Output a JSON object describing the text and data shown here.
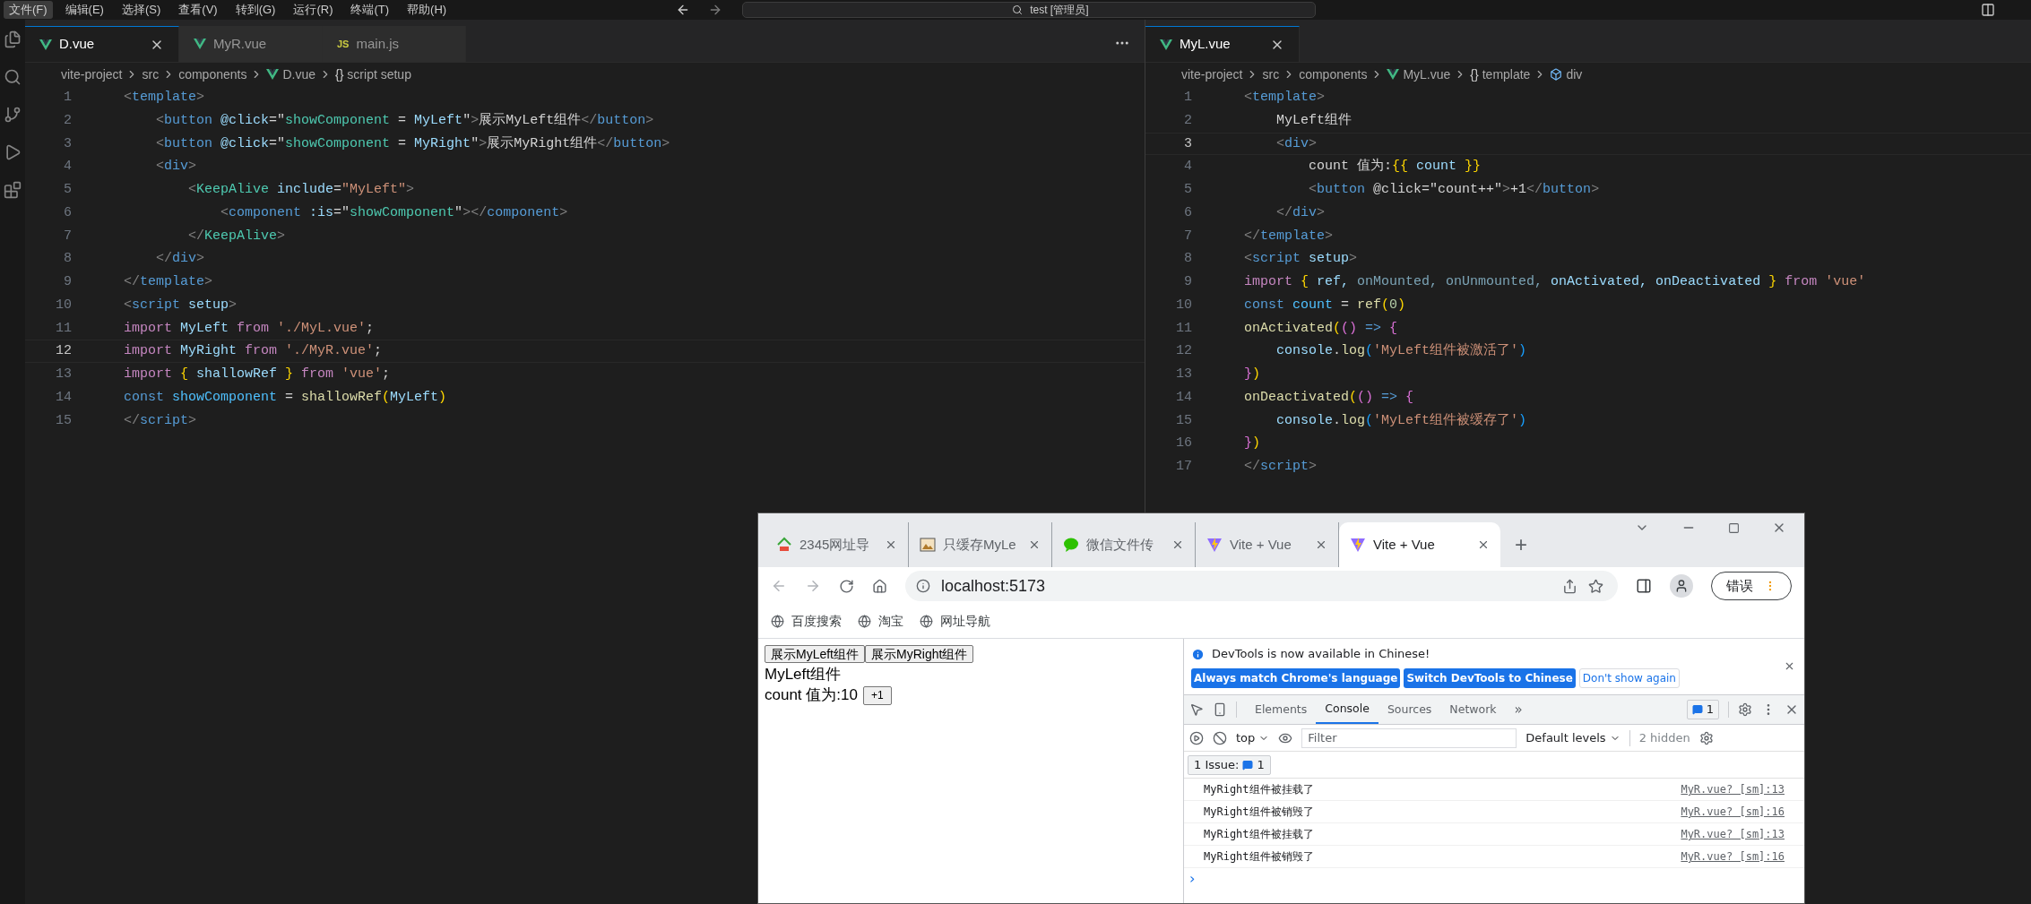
{
  "menu": [
    {
      "label": "文件(F)",
      "selected": true
    },
    {
      "label": "编辑(E)",
      "selected": false
    },
    {
      "label": "选择(S)",
      "selected": false
    },
    {
      "label": "查看(V)",
      "selected": false
    },
    {
      "label": "转到(G)",
      "selected": false
    },
    {
      "label": "运行(R)",
      "selected": false
    },
    {
      "label": "终端(T)",
      "selected": false
    },
    {
      "label": "帮助(H)",
      "selected": false
    }
  ],
  "command_center": {
    "value": "test [管理员]"
  },
  "editors": [
    {
      "tabs": [
        {
          "label": "D.vue",
          "kind": "vue",
          "selected": true
        },
        {
          "label": "MyR.vue",
          "kind": "vue",
          "selected": false
        },
        {
          "label": "main.js",
          "kind": "js",
          "badge": "JS",
          "selected": false
        }
      ],
      "breadcrumbs": [
        {
          "label": "vite-project",
          "kind": "folder"
        },
        {
          "label": "src",
          "kind": "folder"
        },
        {
          "label": "components",
          "kind": "folder"
        },
        {
          "label": "D.vue",
          "kind": "vue"
        },
        {
          "label": "script setup",
          "kind": "braces",
          "symbol": "{}"
        }
      ],
      "lines": [
        {
          "number": "1",
          "current": false,
          "tokens": [
            {
              "text": "<",
              "kind": "p"
            },
            {
              "text": "template",
              "kind": "tag"
            },
            {
              "text": ">",
              "kind": "p"
            }
          ]
        },
        {
          "number": "2",
          "current": false,
          "tokens": [
            {
              "text": "    <",
              "kind": "p"
            },
            {
              "text": "button ",
              "kind": "tag"
            },
            {
              "text": "@click",
              "kind": "attr"
            },
            {
              "text": "=\"",
              "kind": "pl"
            },
            {
              "text": "showComponent",
              "kind": "cls"
            },
            {
              "text": " = ",
              "kind": "pl"
            },
            {
              "text": "MyLeft",
              "kind": "var"
            },
            {
              "text": "\"",
              "kind": "pl"
            },
            {
              "text": ">",
              "kind": "p"
            },
            {
              "text": "展示MyLeft组件",
              "kind": "pl"
            },
            {
              "text": "</",
              "kind": "p"
            },
            {
              "text": "button",
              "kind": "tag"
            },
            {
              "text": ">",
              "kind": "p"
            }
          ]
        },
        {
          "number": "3",
          "current": false,
          "tokens": [
            {
              "text": "    <",
              "kind": "p"
            },
            {
              "text": "button ",
              "kind": "tag"
            },
            {
              "text": "@click",
              "kind": "attr"
            },
            {
              "text": "=\"",
              "kind": "pl"
            },
            {
              "text": "showComponent",
              "kind": "cls"
            },
            {
              "text": " = ",
              "kind": "pl"
            },
            {
              "text": "MyRight",
              "kind": "var"
            },
            {
              "text": "\"",
              "kind": "pl"
            },
            {
              "text": ">",
              "kind": "p"
            },
            {
              "text": "展示MyRight组件",
              "kind": "pl"
            },
            {
              "text": "</",
              "kind": "p"
            },
            {
              "text": "button",
              "kind": "tag"
            },
            {
              "text": ">",
              "kind": "p"
            }
          ]
        },
        {
          "number": "4",
          "current": false,
          "tokens": [
            {
              "text": "    <",
              "kind": "p"
            },
            {
              "text": "div",
              "kind": "tag"
            },
            {
              "text": ">",
              "kind": "p"
            }
          ]
        },
        {
          "number": "5",
          "current": false,
          "tokens": [
            {
              "text": "        <",
              "kind": "p"
            },
            {
              "text": "KeepAlive ",
              "kind": "cls"
            },
            {
              "text": "include",
              "kind": "attr"
            },
            {
              "text": "=",
              "kind": "pl"
            },
            {
              "text": "\"MyLeft\"",
              "kind": "str"
            },
            {
              "text": ">",
              "kind": "p"
            }
          ]
        },
        {
          "number": "6",
          "current": false,
          "tokens": [
            {
              "text": "            <",
              "kind": "p"
            },
            {
              "text": "component ",
              "kind": "tag"
            },
            {
              "text": ":is",
              "kind": "attr"
            },
            {
              "text": "=\"",
              "kind": "pl"
            },
            {
              "text": "showComponent",
              "kind": "cls"
            },
            {
              "text": "\"",
              "kind": "pl"
            },
            {
              "text": "></",
              "kind": "p"
            },
            {
              "text": "component",
              "kind": "tag"
            },
            {
              "text": ">",
              "kind": "p"
            }
          ]
        },
        {
          "number": "7",
          "current": false,
          "tokens": [
            {
              "text": "        </",
              "kind": "p"
            },
            {
              "text": "KeepAlive",
              "kind": "cls"
            },
            {
              "text": ">",
              "kind": "p"
            }
          ]
        },
        {
          "number": "8",
          "current": false,
          "tokens": [
            {
              "text": "    </",
              "kind": "p"
            },
            {
              "text": "div",
              "kind": "tag"
            },
            {
              "text": ">",
              "kind": "p"
            }
          ]
        },
        {
          "number": "9",
          "current": false,
          "tokens": [
            {
              "text": "</",
              "kind": "p"
            },
            {
              "text": "template",
              "kind": "tag"
            },
            {
              "text": ">",
              "kind": "p"
            }
          ]
        },
        {
          "number": "10",
          "current": false,
          "tokens": [
            {
              "text": "<",
              "kind": "p"
            },
            {
              "text": "script ",
              "kind": "tag"
            },
            {
              "text": "setup",
              "kind": "attr"
            },
            {
              "text": ">",
              "kind": "p"
            }
          ]
        },
        {
          "number": "11",
          "current": false,
          "tokens": [
            {
              "text": "import ",
              "kind": "kw"
            },
            {
              "text": "MyLeft ",
              "kind": "var"
            },
            {
              "text": "from ",
              "kind": "kw"
            },
            {
              "text": "'./MyL.vue'",
              "kind": "str"
            },
            {
              "text": ";",
              "kind": "pl"
            }
          ]
        },
        {
          "number": "12",
          "current": true,
          "tokens": [
            {
              "text": "import ",
              "kind": "kw"
            },
            {
              "text": "MyRight ",
              "kind": "var"
            },
            {
              "text": "from ",
              "kind": "kw"
            },
            {
              "text": "'./MyR.vue'",
              "kind": "str"
            },
            {
              "text": ";",
              "kind": "pl"
            }
          ]
        },
        {
          "number": "13",
          "current": false,
          "tokens": [
            {
              "text": "import ",
              "kind": "kw"
            },
            {
              "text": "{ ",
              "kind": "br"
            },
            {
              "text": "shallowRef ",
              "kind": "var"
            },
            {
              "text": "} ",
              "kind": "br"
            },
            {
              "text": "from ",
              "kind": "kw"
            },
            {
              "text": "'vue'",
              "kind": "str"
            },
            {
              "text": ";",
              "kind": "pl"
            }
          ]
        },
        {
          "number": "14",
          "current": false,
          "tokens": [
            {
              "text": "const ",
              "kind": "tag"
            },
            {
              "text": "showComponent",
              "kind": "cvar"
            },
            {
              "text": " = ",
              "kind": "pl"
            },
            {
              "text": "shallowRef",
              "kind": "fn"
            },
            {
              "text": "(",
              "kind": "br"
            },
            {
              "text": "MyLeft",
              "kind": "var"
            },
            {
              "text": ")",
              "kind": "br"
            }
          ]
        },
        {
          "number": "15",
          "current": false,
          "tokens": [
            {
              "text": "</",
              "kind": "p"
            },
            {
              "text": "script",
              "kind": "tag"
            },
            {
              "text": ">",
              "kind": "p"
            }
          ]
        }
      ]
    },
    {
      "tabs": [
        {
          "label": "MyL.vue",
          "kind": "vue",
          "selected": true
        }
      ],
      "breadcrumbs": [
        {
          "label": "vite-project",
          "kind": "folder"
        },
        {
          "label": "src",
          "kind": "folder"
        },
        {
          "label": "components",
          "kind": "folder"
        },
        {
          "label": "MyL.vue",
          "kind": "vue"
        },
        {
          "label": "template",
          "kind": "braces",
          "symbol": "{}"
        },
        {
          "label": "div",
          "kind": "cube"
        }
      ],
      "lines": [
        {
          "number": "1",
          "current": false,
          "tokens": [
            {
              "text": "<",
              "kind": "p"
            },
            {
              "text": "template",
              "kind": "tag"
            },
            {
              "text": ">",
              "kind": "p"
            }
          ]
        },
        {
          "number": "2",
          "current": false,
          "tokens": [
            {
              "text": "    MyLeft组件",
              "kind": "pl"
            }
          ]
        },
        {
          "number": "3",
          "current": true,
          "tokens": [
            {
              "text": "    <",
              "kind": "p"
            },
            {
              "text": "div",
              "kind": "tag"
            },
            {
              "text": ">",
              "kind": "p"
            }
          ]
        },
        {
          "number": "4",
          "current": false,
          "tokens": [
            {
              "text": "        count 值为:",
              "kind": "pl"
            },
            {
              "text": "{{ ",
              "kind": "br"
            },
            {
              "text": "count ",
              "kind": "var"
            },
            {
              "text": "}}",
              "kind": "br"
            }
          ]
        },
        {
          "number": "5",
          "current": false,
          "tokens": [
            {
              "text": "        <",
              "kind": "p"
            },
            {
              "text": "button ",
              "kind": "tag"
            },
            {
              "text": "@click=\"count++\"",
              "kind": "pl"
            },
            {
              "text": ">",
              "kind": "p"
            },
            {
              "text": "+1",
              "kind": "pl"
            },
            {
              "text": "</",
              "kind": "p"
            },
            {
              "text": "button",
              "kind": "tag"
            },
            {
              "text": ">",
              "kind": "p"
            }
          ]
        },
        {
          "number": "6",
          "current": false,
          "tokens": [
            {
              "text": "    </",
              "kind": "p"
            },
            {
              "text": "div",
              "kind": "tag"
            },
            {
              "text": ">",
              "kind": "p"
            }
          ]
        },
        {
          "number": "7",
          "current": false,
          "tokens": [
            {
              "text": "</",
              "kind": "p"
            },
            {
              "text": "template",
              "kind": "tag"
            },
            {
              "text": ">",
              "kind": "p"
            }
          ]
        },
        {
          "number": "8",
          "current": false,
          "tokens": [
            {
              "text": "<",
              "kind": "p"
            },
            {
              "text": "script ",
              "kind": "tag"
            },
            {
              "text": "setup",
              "kind": "attr"
            },
            {
              "text": ">",
              "kind": "p"
            }
          ]
        },
        {
          "number": "9",
          "current": false,
          "tokens": [
            {
              "text": "import ",
              "kind": "kw"
            },
            {
              "text": "{ ",
              "kind": "br"
            },
            {
              "text": "ref, ",
              "kind": "var"
            },
            {
              "text": "onMounted, onUnmounted, ",
              "kind": "dim"
            },
            {
              "text": "onActivated, onDeactivated ",
              "kind": "var"
            },
            {
              "text": "} ",
              "kind": "br"
            },
            {
              "text": "from ",
              "kind": "kw"
            },
            {
              "text": "'vue'",
              "kind": "str"
            }
          ]
        },
        {
          "number": "10",
          "current": false,
          "tokens": [
            {
              "text": "const ",
              "kind": "tag"
            },
            {
              "text": "count",
              "kind": "cvar"
            },
            {
              "text": " = ",
              "kind": "pl"
            },
            {
              "text": "ref",
              "kind": "fn"
            },
            {
              "text": "(",
              "kind": "br"
            },
            {
              "text": "0",
              "kind": "num"
            },
            {
              "text": ")",
              "kind": "br"
            }
          ]
        },
        {
          "number": "11",
          "current": false,
          "tokens": [
            {
              "text": "onActivated",
              "kind": "fn"
            },
            {
              "text": "(",
              "kind": "br"
            },
            {
              "text": "()",
              "kind": "br2"
            },
            {
              "text": " => ",
              "kind": "tag"
            },
            {
              "text": "{",
              "kind": "br2"
            }
          ]
        },
        {
          "number": "12",
          "current": false,
          "tokens": [
            {
              "text": "    console",
              "kind": "var"
            },
            {
              "text": ".",
              "kind": "pl"
            },
            {
              "text": "log",
              "kind": "fn"
            },
            {
              "text": "(",
              "kind": "br3"
            },
            {
              "text": "'MyLeft组件被激活了'",
              "kind": "str"
            },
            {
              "text": ")",
              "kind": "br3"
            }
          ]
        },
        {
          "number": "13",
          "current": false,
          "tokens": [
            {
              "text": "}",
              "kind": "br2"
            },
            {
              "text": ")",
              "kind": "br"
            }
          ]
        },
        {
          "number": "14",
          "current": false,
          "tokens": [
            {
              "text": "onDeactivated",
              "kind": "fn"
            },
            {
              "text": "(",
              "kind": "br"
            },
            {
              "text": "()",
              "kind": "br2"
            },
            {
              "text": " => ",
              "kind": "tag"
            },
            {
              "text": "{",
              "kind": "br2"
            }
          ]
        },
        {
          "number": "15",
          "current": false,
          "tokens": [
            {
              "text": "    console",
              "kind": "var"
            },
            {
              "text": ".",
              "kind": "pl"
            },
            {
              "text": "log",
              "kind": "fn"
            },
            {
              "text": "(",
              "kind": "br3"
            },
            {
              "text": "'MyLeft组件被缓存了'",
              "kind": "str"
            },
            {
              "text": ")",
              "kind": "br3"
            }
          ]
        },
        {
          "number": "16",
          "current": false,
          "tokens": [
            {
              "text": "}",
              "kind": "br2"
            },
            {
              "text": ")",
              "kind": "br"
            }
          ]
        },
        {
          "number": "17",
          "current": false,
          "tokens": [
            {
              "text": "</",
              "kind": "p"
            },
            {
              "text": "script",
              "kind": "tag"
            },
            {
              "text": ">",
              "kind": "p"
            }
          ]
        }
      ]
    }
  ],
  "browser": {
    "tabs": [
      {
        "title": "2345网址导",
        "kind": "house",
        "selected": false
      },
      {
        "title": "只缓存MyLe",
        "kind": "image",
        "selected": false
      },
      {
        "title": "微信文件传",
        "kind": "chat",
        "selected": false
      },
      {
        "title": "Vite + Vue",
        "kind": "vite",
        "selected": false
      },
      {
        "title": "Vite + Vue",
        "kind": "vite",
        "selected": true
      }
    ],
    "new_tab": "+",
    "address": "localhost:5173",
    "profile_button": "错误",
    "bookmarks": [
      "百度搜索",
      "淘宝",
      "网址导航"
    ],
    "page": {
      "buttons": [
        "展示MyLeft组件",
        "展示MyRight组件"
      ],
      "heading": "MyLeft组件",
      "count_text": "count 值为:10",
      "increment_button": "+1"
    },
    "devtools": {
      "banner": {
        "message": "DevTools is now available in Chinese!",
        "buttons": [
          {
            "label": "Always match Chrome's language",
            "kind": "primary"
          },
          {
            "label": "Switch DevTools to Chinese",
            "kind": "primary"
          },
          {
            "label": "Don't show again",
            "kind": "secondary"
          }
        ]
      },
      "tabs": [
        {
          "label": "Elements",
          "selected": false
        },
        {
          "label": "Console",
          "selected": true
        },
        {
          "label": "Sources",
          "selected": false
        },
        {
          "label": "Network",
          "selected": false
        }
      ],
      "more_tabs": "»",
      "issues_count": "1",
      "context": "top",
      "filter": {
        "placeholder": "Filter"
      },
      "levels": "Default levels",
      "hidden": "2 hidden",
      "issues_label": "1 Issue:",
      "issues_badge": "1",
      "messages": [
        {
          "text": "MyRight组件被挂载了",
          "source": "MyR.vue? [sm]:13"
        },
        {
          "text": "MyRight组件被销毁了",
          "source": "MyR.vue? [sm]:16"
        },
        {
          "text": "MyRight组件被挂载了",
          "source": "MyR.vue? [sm]:13"
        },
        {
          "text": "MyRight组件被销毁了",
          "source": "MyR.vue? [sm]:16"
        }
      ],
      "prompt": "›"
    }
  }
}
